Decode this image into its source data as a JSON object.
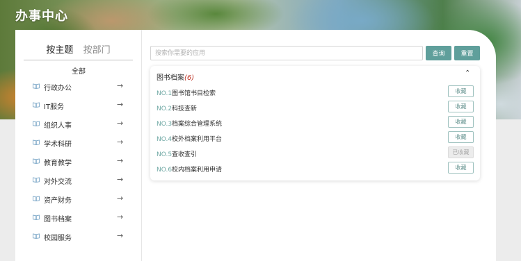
{
  "header": {
    "title": "办事中心"
  },
  "sidebar": {
    "tabs": [
      {
        "label": "按主题",
        "active": true
      },
      {
        "label": "按部门",
        "active": false
      }
    ],
    "all_label": "全部",
    "items": [
      {
        "label": "行政办公",
        "icon": "book-icon"
      },
      {
        "label": "IT服务",
        "icon": "book-icon"
      },
      {
        "label": "组织人事",
        "icon": "book-icon"
      },
      {
        "label": "学术科研",
        "icon": "book-icon"
      },
      {
        "label": "教育教学",
        "icon": "book-icon"
      },
      {
        "label": "对外交流",
        "icon": "book-icon"
      },
      {
        "label": "资产财务",
        "icon": "book-icon"
      },
      {
        "label": "图书档案",
        "icon": "book-icon"
      },
      {
        "label": "校园服务",
        "icon": "book-icon"
      }
    ],
    "arrow_glyph": "→"
  },
  "search": {
    "placeholder": "搜索你需要的应用",
    "value": "",
    "query_label": "查询",
    "reset_label": "重置"
  },
  "results": {
    "category": "图书档案",
    "count": "(6)",
    "collapse_glyph": "⌃",
    "items": [
      {
        "no": "NO.1",
        "name": "图书馆书目检索",
        "action": "收藏",
        "collected": false
      },
      {
        "no": "NO.2",
        "name": "科技查新",
        "action": "收藏",
        "collected": false
      },
      {
        "no": "NO.3",
        "name": "档案综合管理系统",
        "action": "收藏",
        "collected": false
      },
      {
        "no": "NO.4",
        "name": "校外档案利用平台",
        "action": "收藏",
        "collected": false
      },
      {
        "no": "NO.5",
        "name": "查收查引",
        "action": "已收藏",
        "collected": true
      },
      {
        "no": "NO.6",
        "name": "校内档案利用申请",
        "action": "收藏",
        "collected": false
      }
    ]
  },
  "colors": {
    "accent": "#5f9f9b",
    "accent_text": "#6fa8a4",
    "count": "#c0392b"
  }
}
